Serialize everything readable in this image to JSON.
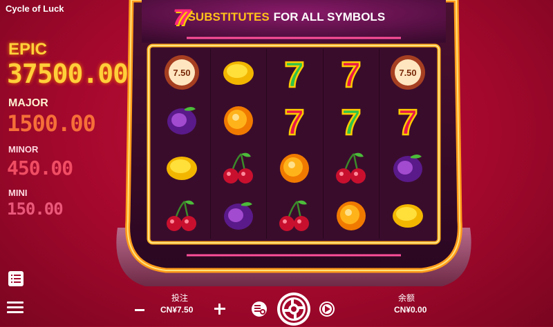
{
  "app": {
    "title": "Cycle of Luck"
  },
  "jackpots": [
    {
      "name": "EPIC",
      "value": "37500.00"
    },
    {
      "name": "MAJOR",
      "value": "1500.00"
    },
    {
      "name": "MINOR",
      "value": "450.00"
    },
    {
      "name": "MINI",
      "value": "150.00"
    }
  ],
  "banner": {
    "symbol": "77",
    "highlight": "SUBSTITUTES",
    "rest": "FOR ALL SYMBOLS"
  },
  "reels": [
    [
      "coin",
      "lemon",
      "seven-green",
      "seven-red",
      "coin"
    ],
    [
      "plum",
      "orange",
      "seven-red",
      "seven-green",
      "seven-red"
    ],
    [
      "lemon",
      "cherry",
      "orange",
      "cherry",
      "plum"
    ],
    [
      "cherry",
      "plum",
      "cherry",
      "orange",
      "lemon"
    ]
  ],
  "coin_values": [
    "7.50",
    "7.50"
  ],
  "controls": {
    "bet_label": "投注",
    "bet_value": "CN¥7.50",
    "balance_label": "余额",
    "balance_value": "CN¥0.00",
    "minus": "−",
    "plus": "+"
  },
  "colors": {
    "bg": "#a3082c",
    "frame": "#ffb020",
    "epic": "#ffcf3a",
    "major": "#ff7b3a",
    "minor": "#ff5a6e",
    "mini": "#ff6d8f"
  }
}
